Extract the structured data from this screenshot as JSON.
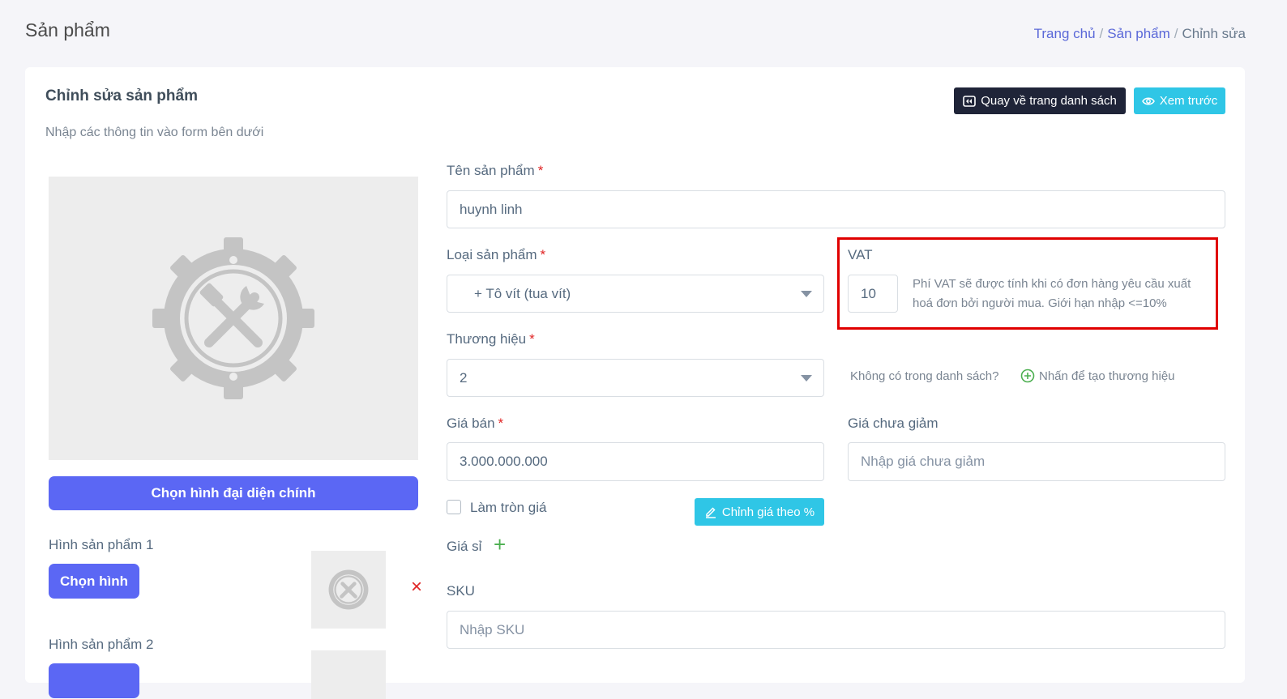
{
  "page": {
    "title": "Sản phẩm"
  },
  "breadcrumb": {
    "home": "Trang chủ",
    "products": "Sản phẩm",
    "current": "Chỉnh sửa",
    "sep": "/"
  },
  "card": {
    "title": "Chỉnh sửa sản phẩm",
    "subtitle": "Nhập các thông tin vào form bên dưới"
  },
  "toolbar": {
    "back_label": "Quay về trang danh sách",
    "preview_label": "Xem trước"
  },
  "images": {
    "main_button": "Chọn hình đại diện chính",
    "item1_label": "Hình sản phẩm 1",
    "item2_label": "Hình sản phẩm 2",
    "pick_button": "Chọn hình",
    "remove_icon": "×"
  },
  "form": {
    "name": {
      "label": "Tên sản phẩm",
      "required": "*",
      "value": "huynh linh"
    },
    "type": {
      "label": "Loại sản phẩm",
      "required": "*",
      "value": "+ Tô vít (tua vít)"
    },
    "vat": {
      "label": "VAT",
      "value": "10",
      "note": "Phí VAT sẽ được tính khi có đơn hàng yêu cầu xuất hoá đơn bởi người mua. Giới hạn nhập <=10%"
    },
    "brand": {
      "label": "Thương hiệu",
      "required": "*",
      "value": "2",
      "hint": "Không có trong danh sách?",
      "create_label": "Nhấn để tạo thương hiệu"
    },
    "price": {
      "label": "Giá bán",
      "required": "*",
      "value": "3.000.000.000"
    },
    "original_price": {
      "label": "Giá chưa giảm",
      "placeholder": "Nhập giá chưa giảm"
    },
    "round_price": {
      "label": "Làm tròn giá",
      "checked": false
    },
    "percent_button": "Chỉnh giá theo %",
    "wholesale": {
      "label": "Giá sỉ",
      "add_icon": "+"
    },
    "sku": {
      "label": "SKU",
      "placeholder": "Nhập SKU"
    }
  },
  "colors": {
    "primary": "#5b67f4",
    "info": "#2fc6e6",
    "dark": "#1f2438",
    "danger": "#e00000",
    "success": "#4caf50"
  }
}
